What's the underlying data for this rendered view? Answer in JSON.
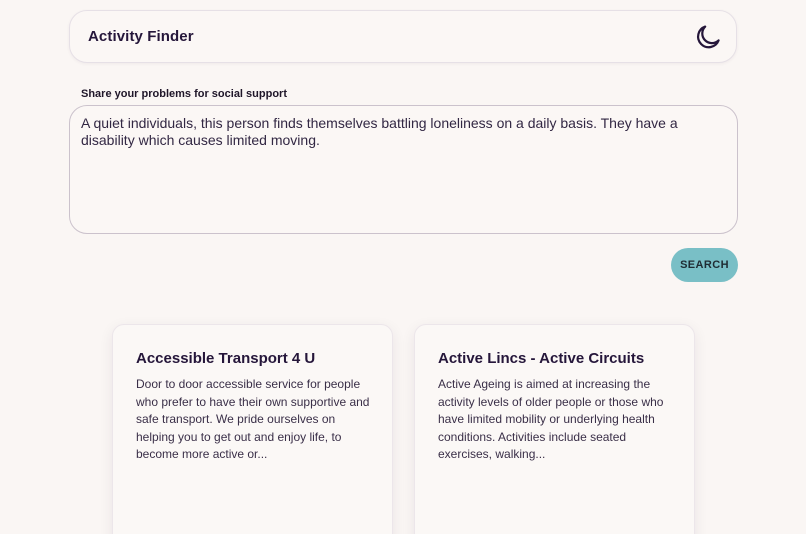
{
  "header": {
    "title": "Activity Finder",
    "theme_toggle_icon": "moon-icon"
  },
  "search_form": {
    "label": "Share your problems for social support",
    "input_value": "A quiet individuals, this person finds themselves battling loneliness on a daily basis. They have a disability which causes limited moving.",
    "button_label": "SEARCH"
  },
  "results": [
    {
      "title": "Accessible Transport 4 U",
      "description": "Door to door accessible service for people who prefer to have their own supportive and safe transport. We pride ourselves on helping you to get out and enjoy life, to become more active or..."
    },
    {
      "title": "Active Lincs - Active Circuits",
      "description": "Active Ageing is aimed at increasing the activity levels of older people or those who have limited mobility or underlying health conditions. Activities include seated exercises, walking..."
    }
  ],
  "colors": {
    "background": "#faf6f4",
    "accent": "#79bfc6",
    "text": "#241534"
  }
}
